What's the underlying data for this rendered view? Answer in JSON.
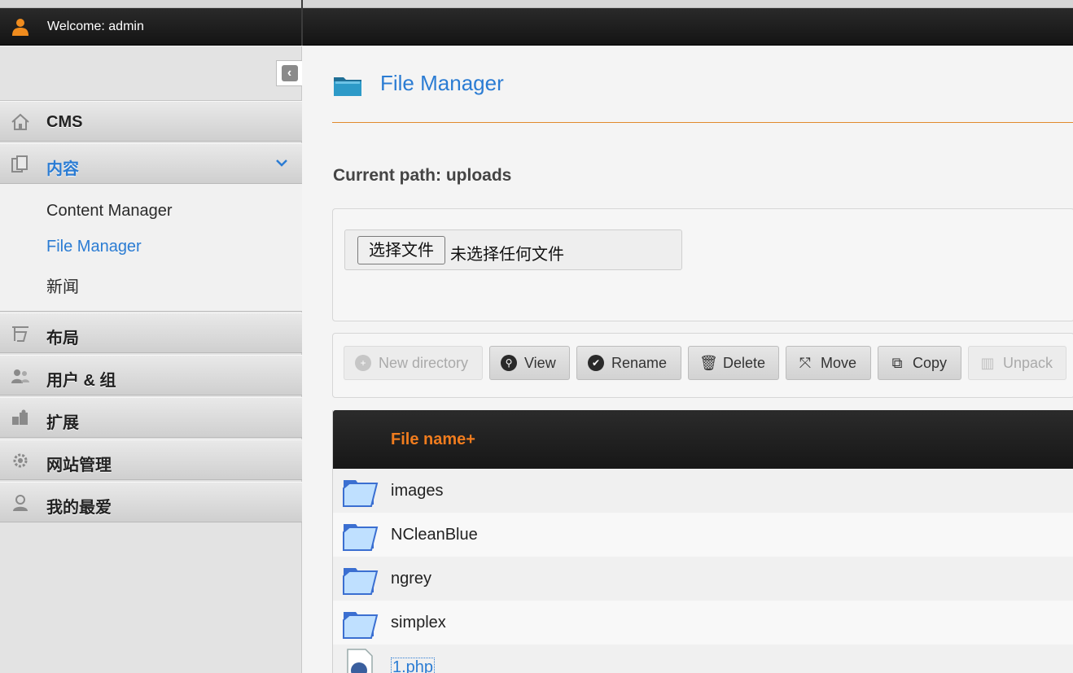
{
  "header": {
    "welcome": "Welcome: admin"
  },
  "sidebar": {
    "items": [
      {
        "label": "CMS",
        "icon": "home-icon"
      },
      {
        "label": "内容",
        "icon": "content-icon",
        "active": true
      },
      {
        "label": "布局",
        "icon": "layout-icon"
      },
      {
        "label": "用户 & 组",
        "icon": "users-icon"
      },
      {
        "label": "扩展",
        "icon": "puzzle-icon"
      },
      {
        "label": "网站管理",
        "icon": "gear-icon"
      },
      {
        "label": "我的最爱",
        "icon": "favorite-user-icon"
      }
    ],
    "submenu": [
      {
        "label": "Content Manager"
      },
      {
        "label": "File Manager",
        "active": true
      },
      {
        "label": "新闻"
      }
    ]
  },
  "main": {
    "title": "File Manager",
    "current_path": "Current path: uploads",
    "upload": {
      "button_label": "选择文件",
      "status": "未选择任何文件"
    },
    "toolbar": {
      "new_directory": "New directory",
      "view": "View",
      "rename": "Rename",
      "delete": "Delete",
      "move": "Move",
      "copy": "Copy",
      "unpack": "Unpack"
    },
    "table": {
      "header": "File name+",
      "rows": [
        {
          "name": "images",
          "type": "folder"
        },
        {
          "name": "NCleanBlue",
          "type": "folder"
        },
        {
          "name": "ngrey",
          "type": "folder"
        },
        {
          "name": "simplex",
          "type": "folder"
        },
        {
          "name": "1.php",
          "type": "file"
        }
      ]
    }
  },
  "colors": {
    "accent": "#2b7cd3",
    "header_orange": "#f07c1e",
    "user_icon": "#f08c1e"
  }
}
